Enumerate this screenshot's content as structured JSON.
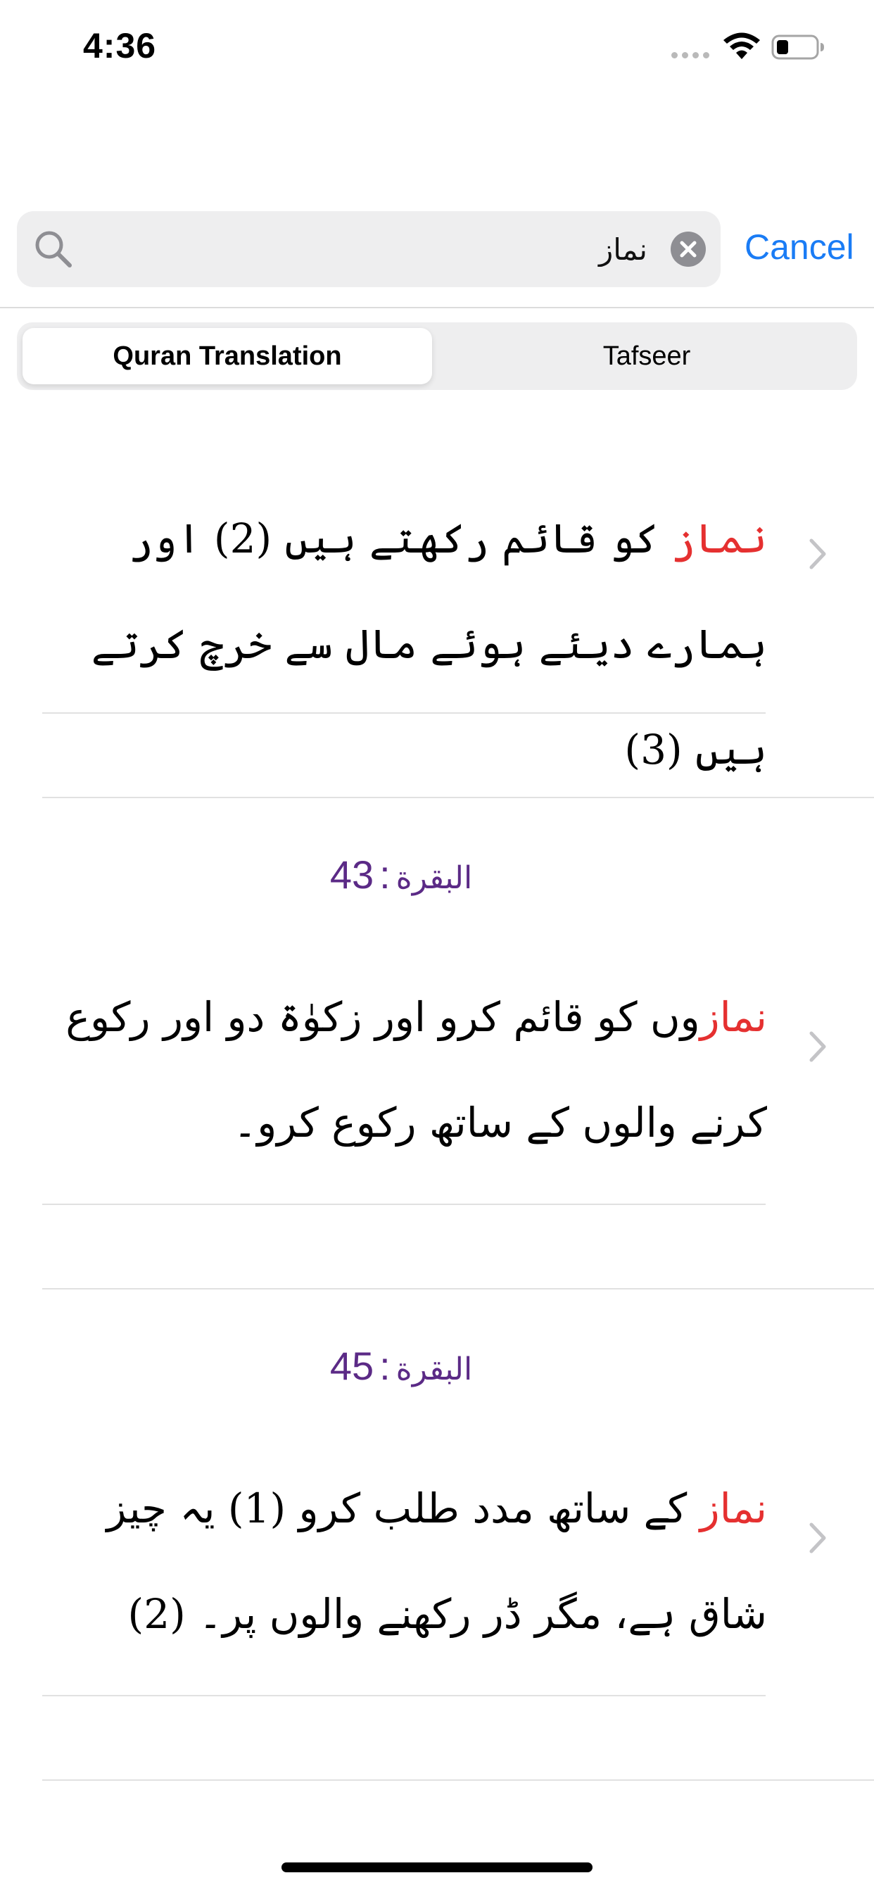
{
  "status_bar": {
    "time": "4:36"
  },
  "search": {
    "query": "نماز",
    "cancel_label": "Cancel"
  },
  "tabs": [
    {
      "label": "Quran Translation",
      "selected": true
    },
    {
      "label": "Tafseer",
      "selected": false
    }
  ],
  "results": [
    {
      "highlight": "نماز",
      "text": " کو قائم رکھتے ہیں (2) اور ہمارے دیئے ہوئے مال سے خرچ کرتے ہیں (3)"
    },
    {
      "surah": "البقرة",
      "ayah": "43",
      "highlight": "نماز",
      "text": "وں کو قائم کرو اور زکوٰۃ دو اور رکوع کرنے والوں کے ساتھ رکوع کرو۔"
    },
    {
      "surah": "البقرة",
      "ayah": "45",
      "highlight": "نماز",
      "text": " کے ساتھ مدد طلب کرو (1) یہ چیز شاق ہے، مگر ڈر رکھنے والوں پر۔ (2)"
    }
  ],
  "colors": {
    "accent": "#1a7cf5",
    "highlight": "#e53030",
    "reference": "#5b2a86"
  }
}
